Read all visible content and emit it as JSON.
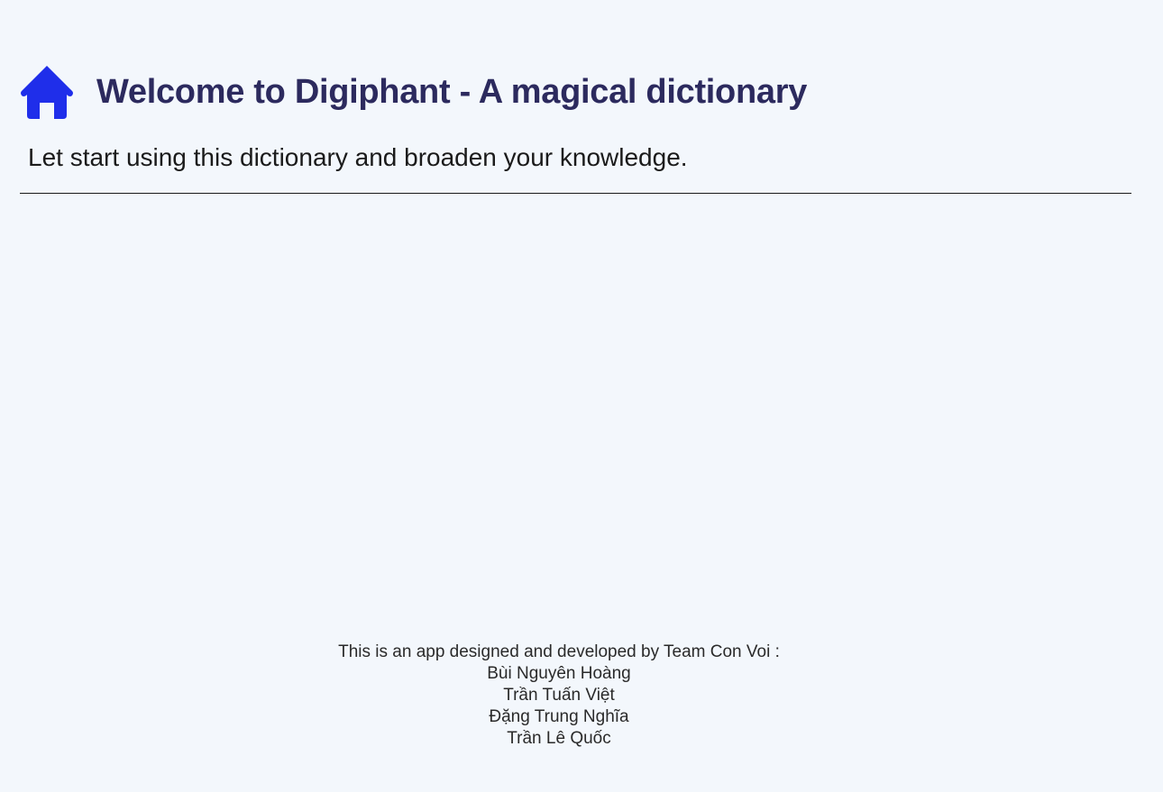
{
  "header": {
    "icon": "home-icon",
    "icon_color": "#1f2eea",
    "title": "Welcome to Digiphant - A magical dictionary",
    "subtitle": "Let start using this dictionary and broaden your knowledge."
  },
  "footer": {
    "intro": "This is an app designed and developed by Team Con Voi :",
    "members": [
      "Bùi Nguyên Hoàng",
      "Trần Tuấn Việt",
      "Đặng Trung Nghĩa",
      "Trần Lê Quốc"
    ]
  }
}
